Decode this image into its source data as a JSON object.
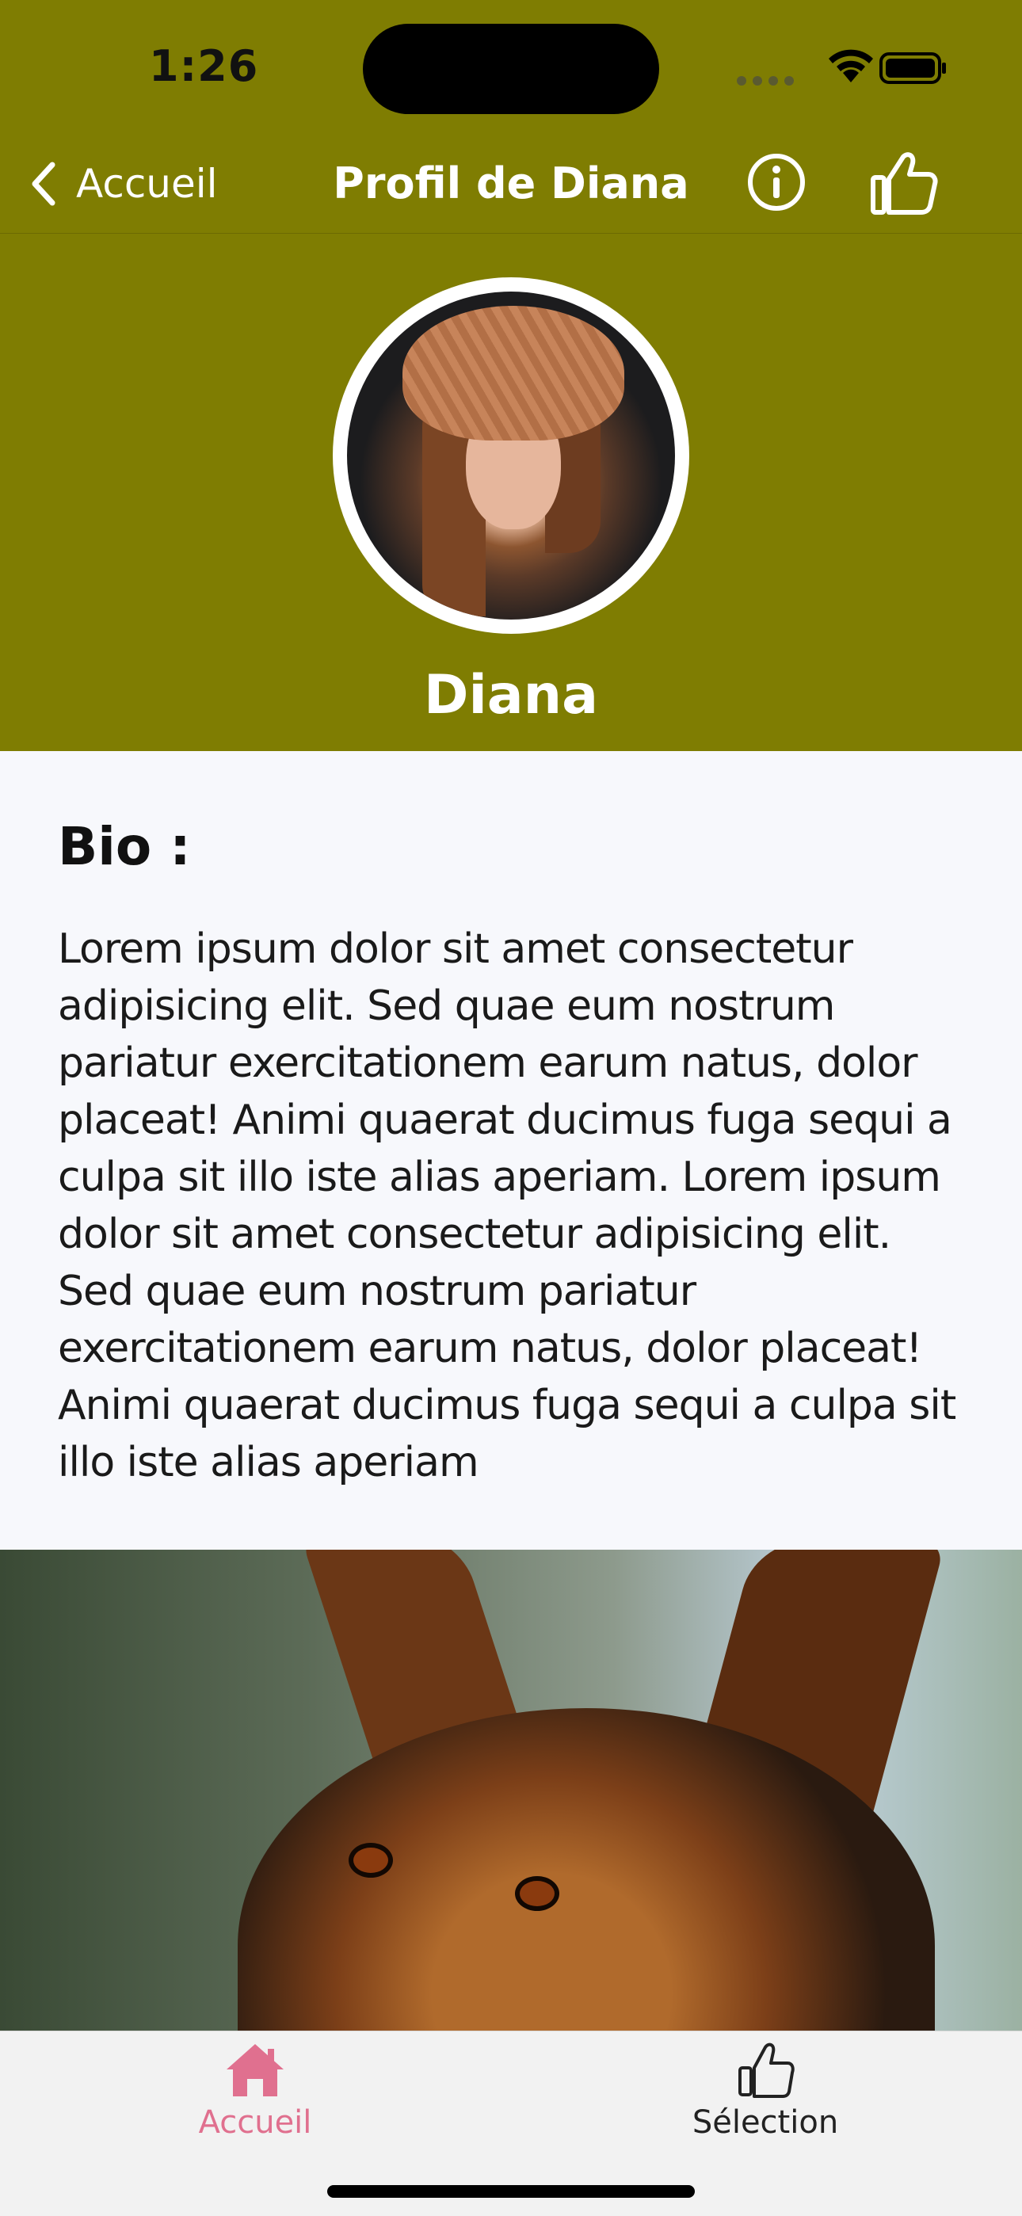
{
  "status_bar": {
    "time": "1:26"
  },
  "nav": {
    "back_label": "Accueil",
    "title": "Profil de Diana",
    "info_icon": "info-circle-icon",
    "like_icon": "thumbs-up-icon"
  },
  "profile": {
    "name": "Diana",
    "bio_heading": "Bio :",
    "bio_text": "Lorem ipsum dolor sit amet consectetur adipisicing elit. Sed quae eum nostrum pariatur exercitationem earum natus, dolor placeat! Animi quaerat ducimus fuga sequi a culpa sit illo iste alias aperiam. Lorem ipsum dolor sit amet consectetur adipisicing elit. Sed quae eum nostrum pariatur exercitationem earum natus, dolor placeat! Animi quaerat ducimus fuga sequi a culpa sit illo iste alias aperiam"
  },
  "tabs": [
    {
      "label": "Accueil",
      "icon": "home-icon",
      "active": true
    },
    {
      "label": "Sélection",
      "icon": "thumbs-up-icon",
      "active": false
    }
  ],
  "colors": {
    "header_bg": "#7f7d02",
    "active_tab": "#e0708f"
  }
}
